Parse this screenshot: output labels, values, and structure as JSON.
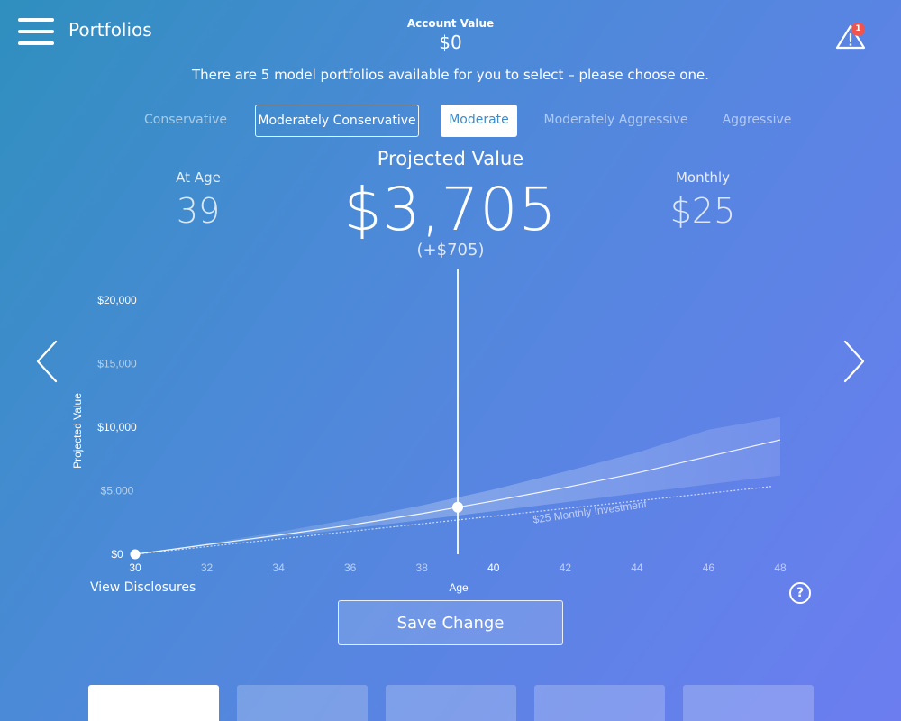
{
  "header": {
    "title": "Portfolios",
    "account_label": "Account Value",
    "account_value": "$0",
    "alert_count": "1"
  },
  "instructions": "There are 5 model portfolios available for you to select – please choose one.",
  "tabs": [
    {
      "label": "Conservative",
      "state": "inactive"
    },
    {
      "label": "Moderately Conservative",
      "state": "outlined"
    },
    {
      "label": "Moderate",
      "state": "active"
    },
    {
      "label": "Moderately Aggressive",
      "state": "inactive"
    },
    {
      "label": "Aggressive",
      "state": "inactive"
    }
  ],
  "summary": {
    "age_label": "At Age",
    "age_value": "39",
    "projected_label": "Projected Value",
    "projected_value": "$3,705",
    "projected_change": "(+$705)",
    "monthly_label": "Monthly",
    "monthly_value": "$25"
  },
  "chart_data": {
    "type": "line",
    "ylabel": "Projected Value",
    "xlabel": "Age",
    "xlim": [
      29.3,
      48.3
    ],
    "ylim": [
      0,
      20000
    ],
    "y_ticks": [
      {
        "value": 0,
        "label": "$0",
        "emphasis": true
      },
      {
        "value": 5000,
        "label": "$5,000",
        "emphasis": false
      },
      {
        "value": 10000,
        "label": "$10,000",
        "emphasis": true
      },
      {
        "value": 15000,
        "label": "$15,000",
        "emphasis": false
      },
      {
        "value": 20000,
        "label": "$20,000",
        "emphasis": true
      }
    ],
    "x_ticks": [
      {
        "value": 30,
        "label": "30",
        "emphasis": true
      },
      {
        "value": 32,
        "label": "32",
        "emphasis": false
      },
      {
        "value": 34,
        "label": "34",
        "emphasis": false
      },
      {
        "value": 36,
        "label": "36",
        "emphasis": false
      },
      {
        "value": 38,
        "label": "38",
        "emphasis": false
      },
      {
        "value": 40,
        "label": "40",
        "emphasis": true
      },
      {
        "value": 42,
        "label": "42",
        "emphasis": false
      },
      {
        "value": 44,
        "label": "44",
        "emphasis": false
      },
      {
        "value": 46,
        "label": "46",
        "emphasis": false
      },
      {
        "value": 48,
        "label": "48",
        "emphasis": false
      }
    ],
    "series": [
      {
        "name": "",
        "style": "solid",
        "x": [
          30,
          32,
          34,
          36,
          38,
          39,
          40,
          42,
          44,
          46,
          48
        ],
        "values": [
          0,
          750,
          1500,
          2300,
          3200,
          3705,
          4200,
          5250,
          6400,
          7700,
          9000
        ]
      },
      {
        "name": "$25 Monthly Investment",
        "style": "dotted",
        "x": [
          30,
          32,
          34,
          36,
          38,
          40,
          42,
          44,
          46,
          47.8
        ],
        "values": [
          0,
          600,
          1200,
          1800,
          2400,
          3000,
          3600,
          4200,
          4800,
          5350
        ]
      }
    ],
    "band": {
      "x": [
        30,
        32,
        34,
        36,
        38,
        40,
        42,
        44,
        46,
        48
      ],
      "upper": [
        0,
        850,
        1750,
        2750,
        3850,
        5100,
        6500,
        8000,
        9800,
        10800
      ],
      "lower": [
        0,
        700,
        1350,
        2000,
        2700,
        3400,
        4100,
        4800,
        5500,
        6200
      ]
    },
    "start_marker": {
      "x": 30,
      "y": 0
    },
    "current_marker": {
      "x": 39,
      "y": 3705
    },
    "grid": false
  },
  "footer": {
    "disclosures": "View Disclosures",
    "help": "?",
    "save_label": "Save Change"
  },
  "cards": [
    {
      "label": "",
      "selected": true
    },
    {
      "label": "",
      "selected": false
    },
    {
      "label": "",
      "selected": false
    },
    {
      "label": "",
      "selected": false
    },
    {
      "label": "",
      "selected": false
    }
  ],
  "colors": {
    "accent": "#3f8bc6",
    "badge": "#f0544d",
    "bg_start": "#2f8fbe",
    "bg_end": "#6c7df0"
  },
  "icons": {
    "menu": "menu-icon",
    "alert": "alert-icon",
    "prev": "chevron-left-icon",
    "next": "chevron-right-icon",
    "help": "help-icon"
  }
}
